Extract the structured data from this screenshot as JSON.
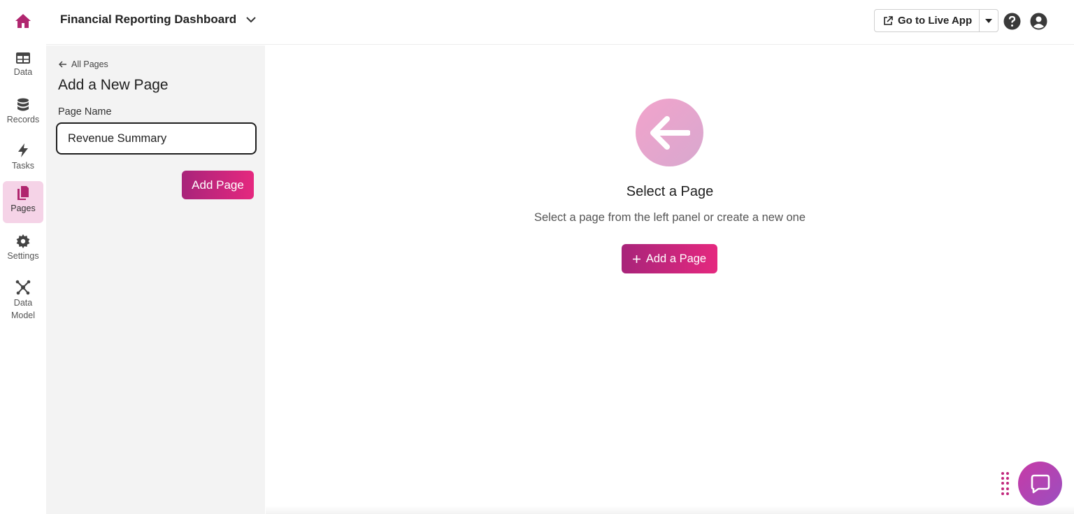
{
  "app": {
    "title": "Financial Reporting Dashboard",
    "accent_color": "#c2287d",
    "gradient_start": "#a8247a",
    "gradient_end": "#e5287f"
  },
  "rail": {
    "items": [
      {
        "label": "Data",
        "icon": "table-icon"
      },
      {
        "label": "Records",
        "icon": "database-icon"
      },
      {
        "label": "Tasks",
        "icon": "lightning-icon"
      },
      {
        "label": "Pages",
        "icon": "pages-icon",
        "active": true
      },
      {
        "label": "Settings",
        "icon": "gear-icon"
      },
      {
        "label": "Data Model",
        "icon": "network-icon"
      }
    ]
  },
  "topbar": {
    "live_app_label": "Go to Live App"
  },
  "panel": {
    "back_label": "All Pages",
    "title": "Add a New Page",
    "field_label": "Page Name",
    "field_value": "Revenue Summary",
    "submit_label": "Add Page"
  },
  "main": {
    "empty_title": "Select a Page",
    "empty_subtitle": "Select a page from the left panel or create a new one",
    "add_button_label": "Add a Page"
  }
}
